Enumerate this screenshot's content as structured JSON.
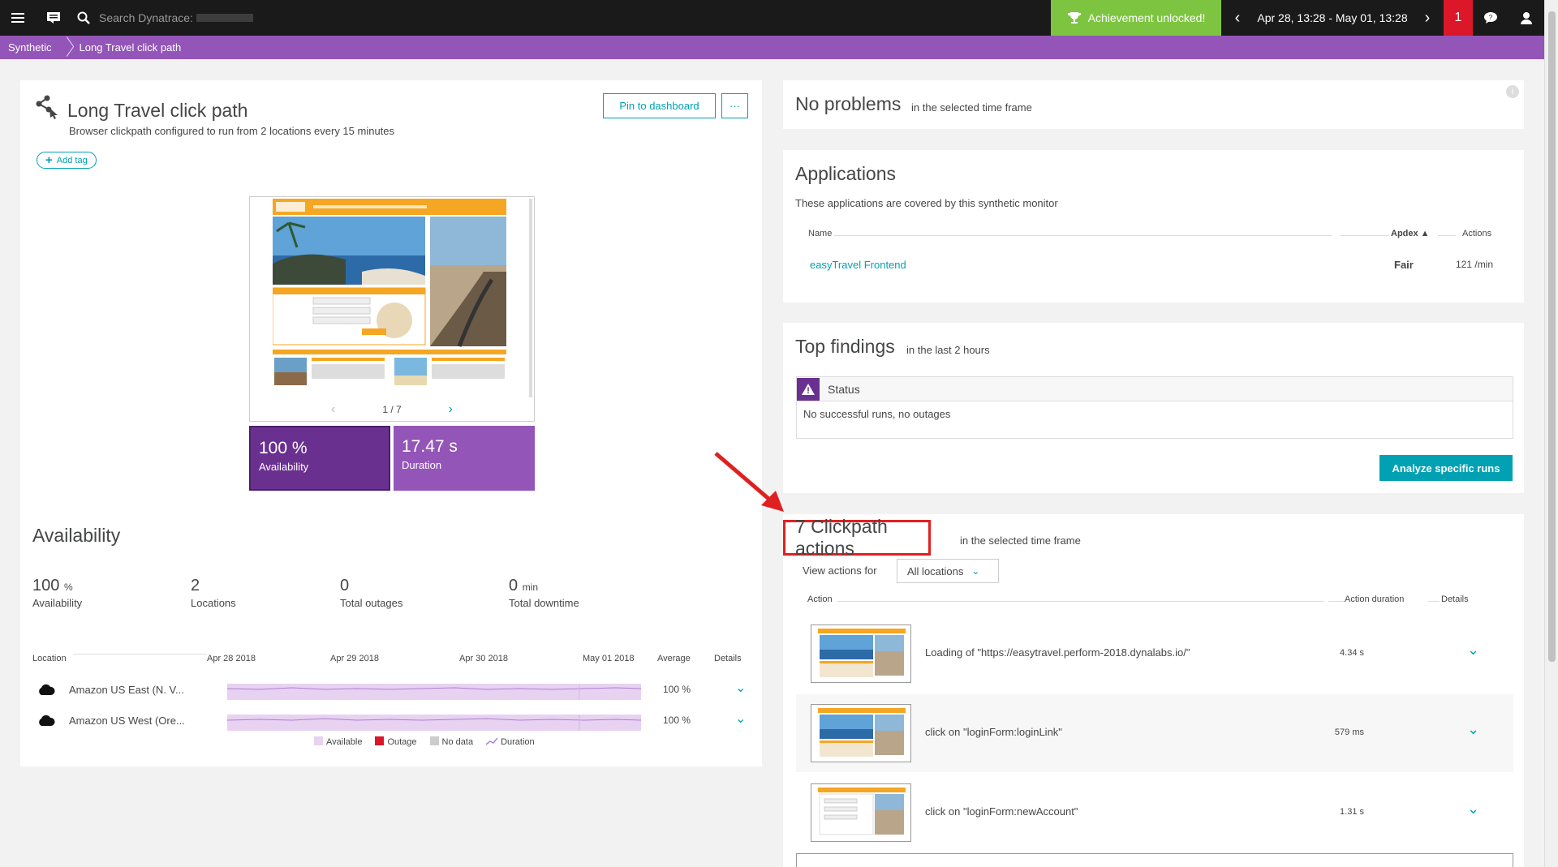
{
  "topbar": {
    "search_placeholder": "Search Dynatrace:",
    "achievement": "Achievement unlocked!",
    "timeframe": "Apr 28, 13:28 - May 01, 13:28",
    "problems_count": "1"
  },
  "breadcrumb": [
    "Synthetic",
    "Long Travel click path"
  ],
  "monitor": {
    "title": "Long Travel click path",
    "subtitle": "Browser clickpath configured to run from 2 locations every 15 minutes",
    "pin_label": "Pin to dashboard",
    "more_label": "···",
    "add_tag": "Add tag",
    "screenshot_pager": "1 / 7",
    "tile_availability_value": "100 %",
    "tile_availability_label": "Availability",
    "tile_duration_value": "17.47 s",
    "tile_duration_label": "Duration"
  },
  "availability": {
    "heading": "Availability",
    "stats": [
      {
        "value": "100",
        "unit": "%",
        "label": "Availability"
      },
      {
        "value": "2",
        "unit": "",
        "label": "Locations"
      },
      {
        "value": "0",
        "unit": "",
        "label": "Total outages"
      },
      {
        "value": "0",
        "unit": "min",
        "label": "Total downtime"
      }
    ],
    "columns": {
      "location": "Location",
      "d1": "Apr 28 2018",
      "d2": "Apr 29 2018",
      "d3": "Apr 30 2018",
      "d4": "May 01 2018",
      "average": "Average",
      "details": "Details"
    },
    "rows": [
      {
        "name": "Amazon US East (N. V...",
        "average": "100 %"
      },
      {
        "name": "Amazon US West (Ore...",
        "average": "100 %"
      }
    ],
    "legend": [
      {
        "label": "Available",
        "color": "#e7d2f1"
      },
      {
        "label": "Outage",
        "color": "#dc172a"
      },
      {
        "label": "No data",
        "color": "#cccccc"
      },
      {
        "label": "Duration",
        "color": "#b07ed0"
      }
    ]
  },
  "no_problems": {
    "title": "No problems",
    "subtitle": "in the selected time frame"
  },
  "applications": {
    "title": "Applications",
    "subtitle": "These applications are covered by this synthetic monitor",
    "col_name": "Name",
    "col_apdex": "Apdex ▲",
    "col_actions": "Actions",
    "rows": [
      {
        "name": "easyTravel Frontend",
        "apdex": "Fair",
        "actions": "121 /min"
      }
    ]
  },
  "findings": {
    "title": "Top findings",
    "subtitle": "in the last 2 hours",
    "status_label": "Status",
    "status_text": "No successful runs, no outages",
    "analyze_button": "Analyze specific runs"
  },
  "clickpath": {
    "title": "7 Clickpath actions",
    "subtitle": "in the selected time frame",
    "view_label": "View actions for",
    "location_select": "All locations",
    "col_action": "Action",
    "col_duration": "Action duration",
    "col_details": "Details",
    "actions": [
      {
        "label": "Loading of \"https://easytravel.perform-2018.dynalabs.io/\"",
        "duration": "4.34 s"
      },
      {
        "label": "click on \"loginForm:loginLink\"",
        "duration": "579 ms"
      },
      {
        "label": "click on \"loginForm:newAccount\"",
        "duration": "1.31 s"
      }
    ]
  },
  "colors": {
    "accent": "#00a1b2",
    "purple": "#9355b7",
    "dark_purple": "#6a3090",
    "green": "#7dc540",
    "red": "#dc172a"
  }
}
